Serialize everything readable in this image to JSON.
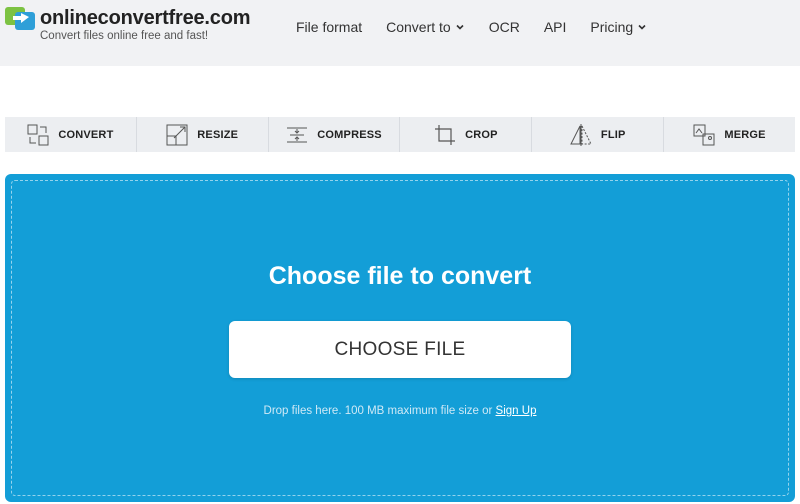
{
  "header": {
    "brand": "onlineconvertfree.com",
    "tagline": "Convert files online free and fast!",
    "nav": [
      {
        "label": "File format",
        "icon": ""
      },
      {
        "label": "Convert to",
        "icon": "chevron-down-icon"
      },
      {
        "label": "OCR",
        "icon": ""
      },
      {
        "label": "API",
        "icon": ""
      },
      {
        "label": "Pricing",
        "icon": "chevron-down-icon"
      }
    ]
  },
  "tools": [
    {
      "label": "CONVERT",
      "icon": "convert-icon"
    },
    {
      "label": "RESIZE",
      "icon": "resize-icon"
    },
    {
      "label": "COMPRESS",
      "icon": "compress-icon"
    },
    {
      "label": "CROP",
      "icon": "crop-icon"
    },
    {
      "label": "FLIP",
      "icon": "flip-icon"
    },
    {
      "label": "MERGE",
      "icon": "merge-icon"
    }
  ],
  "upload": {
    "title": "Choose file to convert",
    "button_label": "CHOOSE FILE",
    "drop_note": "Drop files here. 100 MB maximum file size or",
    "signup_label": "Sign Up"
  },
  "colors": {
    "panel_bg": "#139ed7",
    "header_bg": "#f1f2f4",
    "logo_green": "#7cc242",
    "logo_blue": "#2e9fd8"
  }
}
